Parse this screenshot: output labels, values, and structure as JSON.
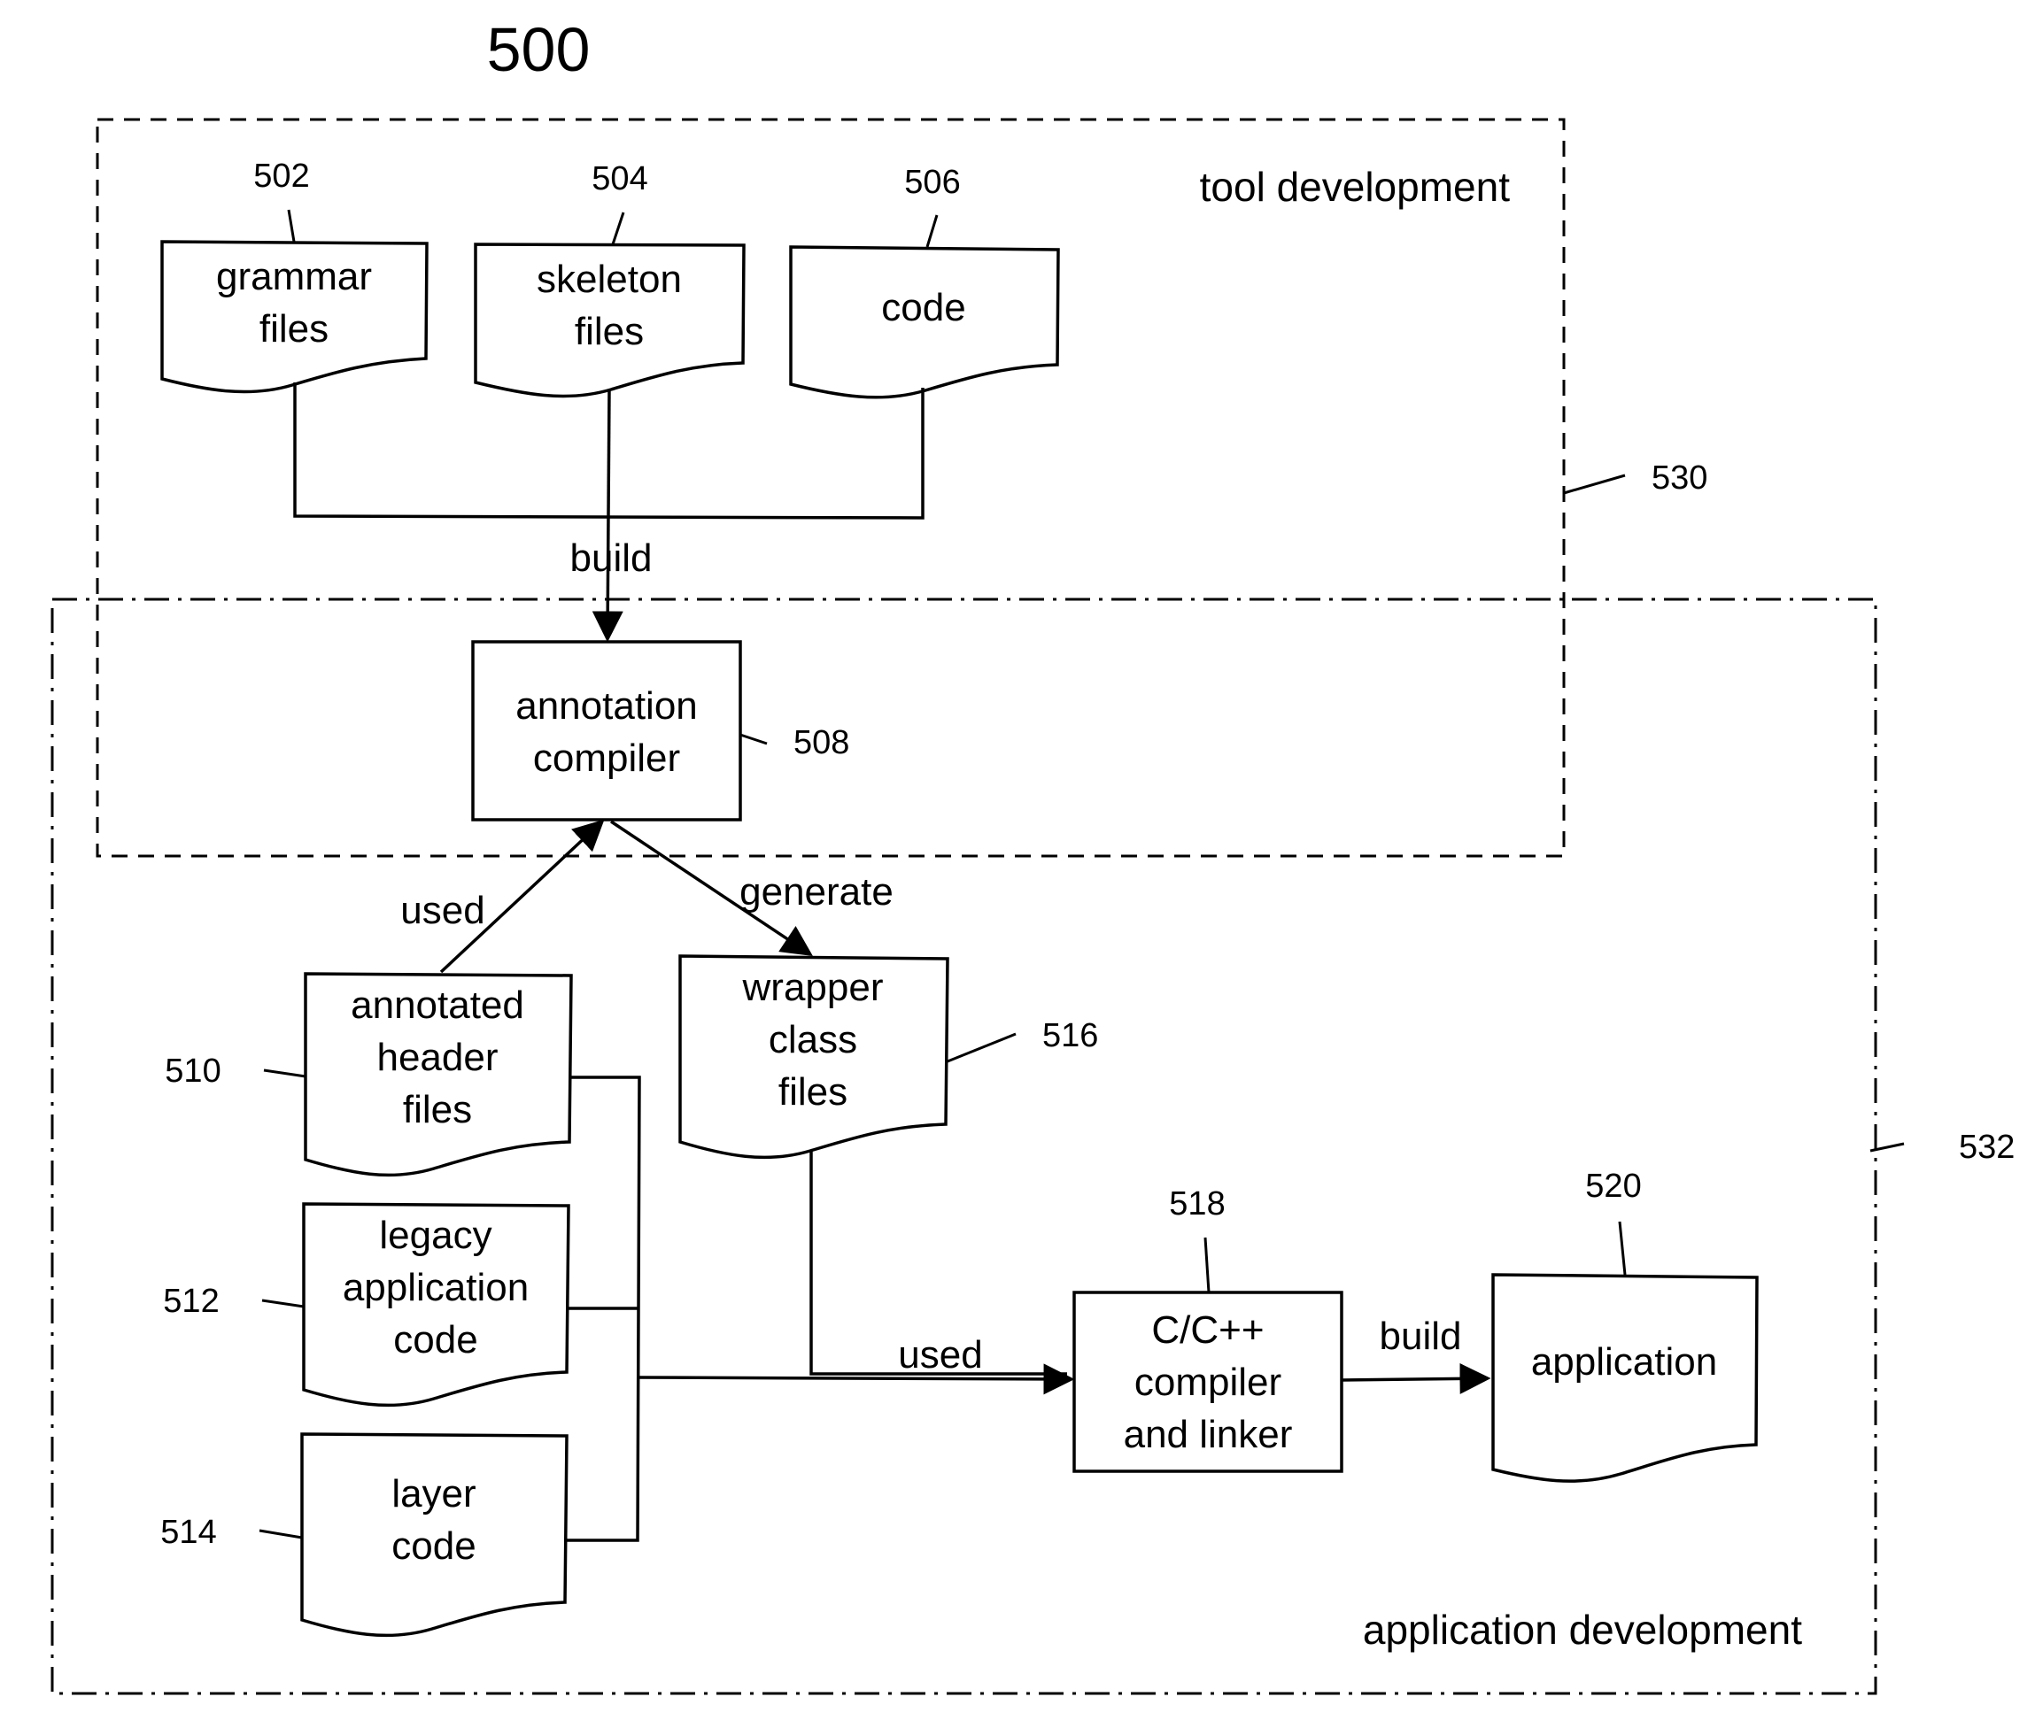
{
  "figure": {
    "number": "500"
  },
  "regions": {
    "tool": {
      "label": "tool development",
      "ref": "530"
    },
    "app": {
      "label": "application development",
      "ref": "532"
    }
  },
  "nodes": {
    "grammar": {
      "ref": "502",
      "lines": [
        "grammar",
        "files"
      ]
    },
    "skeleton": {
      "ref": "504",
      "lines": [
        "skeleton",
        "files"
      ]
    },
    "code": {
      "ref": "506",
      "lines": [
        "code"
      ]
    },
    "annotation_compiler": {
      "ref": "508",
      "lines": [
        "annotation",
        "compiler"
      ]
    },
    "annotated_header": {
      "ref": "510",
      "lines": [
        "annotated",
        "header",
        "files"
      ]
    },
    "legacy": {
      "ref": "512",
      "lines": [
        "legacy",
        "application",
        "code"
      ]
    },
    "layer": {
      "ref": "514",
      "lines": [
        "layer",
        "code"
      ]
    },
    "wrapper": {
      "ref": "516",
      "lines": [
        "wrapper",
        "class",
        "files"
      ]
    },
    "cc_compiler": {
      "ref": "518",
      "lines": [
        "C/C++",
        "compiler",
        "and linker"
      ]
    },
    "application": {
      "ref": "520",
      "lines": [
        "application"
      ]
    }
  },
  "edges": {
    "build_tool": "build",
    "used_headers": "used",
    "generate": "generate",
    "used_compiler": "used",
    "build_app": "build"
  }
}
